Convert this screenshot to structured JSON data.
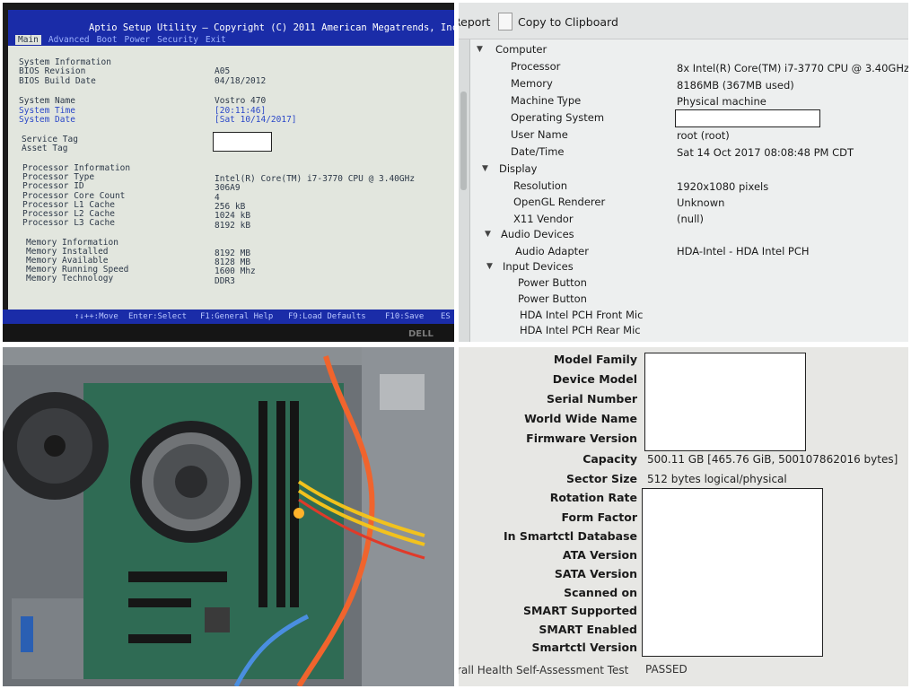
{
  "bios": {
    "title": "Aptio Setup Utility – Copyright (C) 2011 American Megatrends, Inc",
    "tabs": [
      "Main",
      "Advanced",
      "Boot",
      "Power",
      "Security",
      "Exit"
    ],
    "rows": [
      {
        "label": "System Information",
        "value": ""
      },
      {
        "label": "BIOS Revision",
        "value": "A05"
      },
      {
        "label": "BIOS Build Date",
        "value": "04/18/2012"
      },
      {
        "label": "System Name",
        "value": "Vostro 470"
      },
      {
        "label": "System Time",
        "value": "[20:11:46]"
      },
      {
        "label": "System Date",
        "value": "[Sat 10/14/2017]"
      },
      {
        "label": "Service Tag",
        "value": ""
      },
      {
        "label": "Asset Tag",
        "value": ""
      },
      {
        "label": "Processor Information",
        "value": ""
      },
      {
        "label": "Processor Type",
        "value": "Intel(R) Core(TM) i7-3770 CPU @ 3.40GHz"
      },
      {
        "label": "Processor ID",
        "value": "306A9"
      },
      {
        "label": "Processor Core Count",
        "value": "4"
      },
      {
        "label": "Processor L1 Cache",
        "value": "256 kB"
      },
      {
        "label": "Processor L2 Cache",
        "value": "1024 kB"
      },
      {
        "label": "Processor L3 Cache",
        "value": "8192 kB"
      },
      {
        "label": "Memory Information",
        "value": ""
      },
      {
        "label": "Memory Installed",
        "value": "8192 MB"
      },
      {
        "label": "Memory Available",
        "value": "8128 MB"
      },
      {
        "label": "Memory Running Speed",
        "value": "1600 Mhz"
      },
      {
        "label": "Memory Technology",
        "value": "DDR3"
      }
    ],
    "footer": [
      "↑↓++:Move",
      "Enter:Select",
      "F1:General Help",
      "F9:Load Defaults",
      "F10:Save",
      "ES"
    ],
    "monitor_brand": "DELL"
  },
  "hwinfo": {
    "toolbar": {
      "report_label": "Report",
      "copy_label": "Copy to Clipboard"
    },
    "tree": [
      {
        "label": "Computer",
        "value": ""
      },
      {
        "label": "Processor",
        "value": "8x Intel(R) Core(TM) i7-3770 CPU @ 3.40GHz"
      },
      {
        "label": "Memory",
        "value": "8186MB (367MB used)"
      },
      {
        "label": "Machine Type",
        "value": "Physical machine"
      },
      {
        "label": "Operating System",
        "value": ""
      },
      {
        "label": "User Name",
        "value": "root (root)"
      },
      {
        "label": "Date/Time",
        "value": "Sat 14 Oct 2017 08:08:48 PM CDT"
      },
      {
        "label": "Display",
        "value": ""
      },
      {
        "label": "Resolution",
        "value": "1920x1080 pixels"
      },
      {
        "label": "OpenGL Renderer",
        "value": "Unknown"
      },
      {
        "label": "X11 Vendor",
        "value": "(null)"
      },
      {
        "label": "Audio Devices",
        "value": ""
      },
      {
        "label": "Audio Adapter",
        "value": "HDA-Intel - HDA Intel PCH"
      },
      {
        "label": "Input Devices",
        "value": ""
      },
      {
        "label": "Power Button",
        "value": ""
      },
      {
        "label": "Power Button",
        "value": ""
      },
      {
        "label": "HDA Intel PCH Front Mic",
        "value": ""
      },
      {
        "label": "HDA Intel PCH Rear Mic",
        "value": ""
      }
    ]
  },
  "smart": {
    "rows": [
      {
        "label": "Model Family",
        "value": ""
      },
      {
        "label": "Device Model",
        "value": ""
      },
      {
        "label": "Serial Number",
        "value": ""
      },
      {
        "label": "World Wide Name",
        "value": ""
      },
      {
        "label": "Firmware Version",
        "value": ""
      },
      {
        "label": "Capacity",
        "value": "500.11 GB [465.76 GiB, 500107862016 bytes]"
      },
      {
        "label": "Sector Size",
        "value": "512 bytes logical/physical"
      },
      {
        "label": "Rotation Rate",
        "value": ""
      },
      {
        "label": "Form Factor",
        "value": ""
      },
      {
        "label": "In Smartctl Database",
        "value": ""
      },
      {
        "label": "ATA Version",
        "value": ""
      },
      {
        "label": "SATA Version",
        "value": ""
      },
      {
        "label": "Scanned on",
        "value": ""
      },
      {
        "label": "SMART Supported",
        "value": ""
      },
      {
        "label": "SMART Enabled",
        "value": ""
      },
      {
        "label": "Smartctl Version",
        "value": ""
      }
    ],
    "health_label": "rall Health Self-Assessment Test",
    "health_value": "PASSED"
  }
}
